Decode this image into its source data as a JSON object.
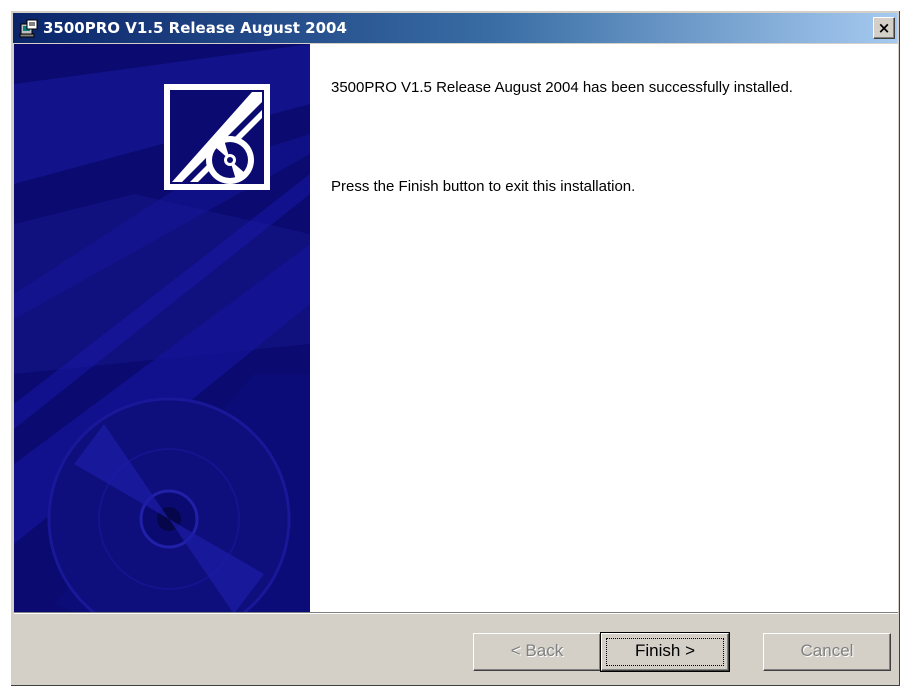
{
  "window": {
    "title": "3500PRO V1.5 Release August 2004",
    "close_glyph": "×"
  },
  "content": {
    "message_installed": "3500PRO V1.5 Release August 2004 has been successfully installed.",
    "message_finish": "Press the Finish button to exit this installation."
  },
  "buttons": {
    "back": "< Back",
    "finish": "Finish >",
    "cancel": "Cancel"
  },
  "icons": {
    "title_icon": "installer-icon",
    "sidebar_logo": "cd-box-logo-icon",
    "close": "close-icon"
  },
  "colors": {
    "titlebar_start": "#0a246a",
    "titlebar_end": "#a6caf0",
    "sidebar_bg": "#0a0a70",
    "dialog_bg": "#d4d0c8"
  }
}
